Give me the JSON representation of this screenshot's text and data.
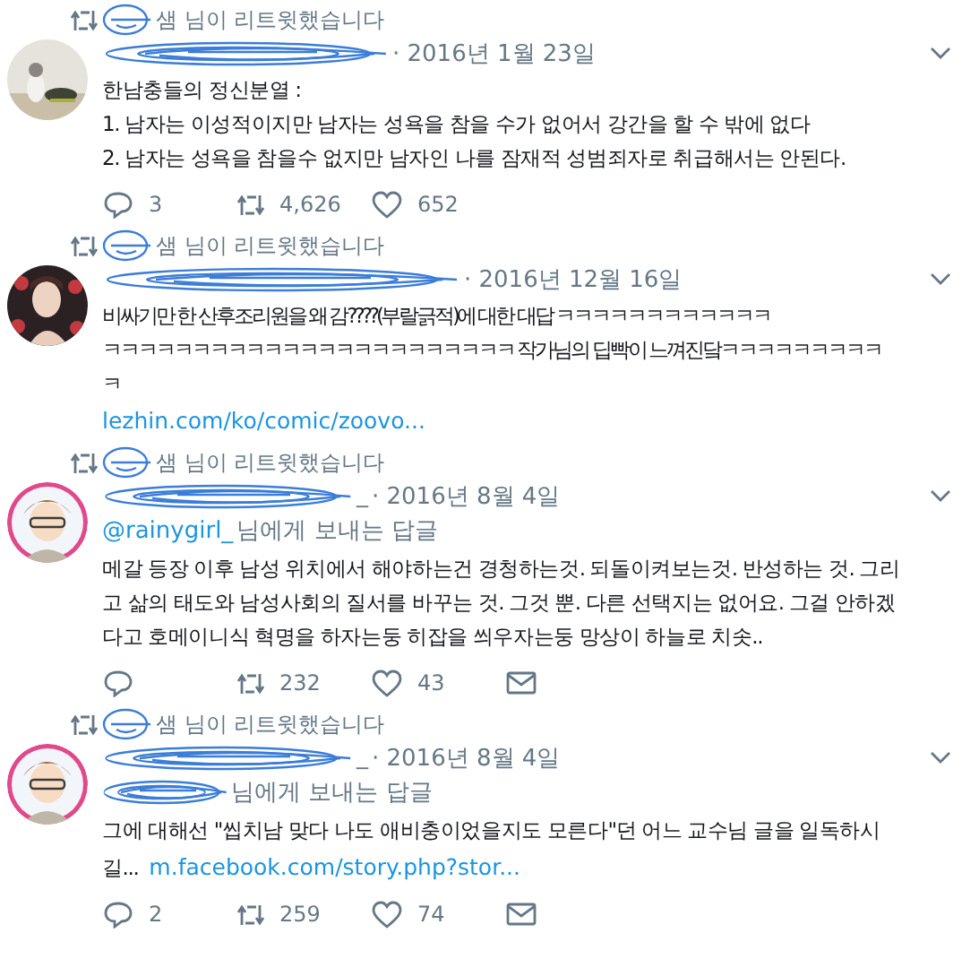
{
  "tweets": [
    {
      "retweet_label": "샘 님이 리트윗했습니다",
      "date": "· 2016년 1월 23일",
      "lines": [
        "한남충들의 정신분열 :",
        "1. 남자는 이성적이지만 남자는 성욕을 참을 수가 없어서 강간을 할 수 밖에 없다",
        "2. 남자는 성욕을 참을수 없지만 남자인 나를 잠재적 성범죄자로 취급해서는 안된다."
      ],
      "actions": [
        {
          "kind": "reply",
          "count": "3"
        },
        {
          "kind": "retweet",
          "count": "4,626"
        },
        {
          "kind": "like",
          "count": "652"
        }
      ]
    },
    {
      "retweet_label": "샘 님이 리트윗했습니다",
      "date": "· 2016년 12월 16일",
      "lines": [
        "비싸기만 한 산후조리원을 왜 감????(부랄긁적)에 대한 대답 ㅋㅋㅋㅋㅋㅋㅋㅋㅋㅋㅋㅋ",
        "ㅋㅋㅋㅋㅋㅋㅋㅋㅋㅋㅋㅋㅋㅋㅋㅋㅋㅋㅋㅋㅋㅋㅋ 작가님의 딥빡이 느껴진닼ㅋㅋㅋㅋㅋㅋㅋㅋㅋ",
        "ㅋ"
      ],
      "link": "lezhin.com/ko/comic/zoovo...",
      "link_inline": false
    },
    {
      "retweet_label": "샘 님이 리트윗했습니다",
      "name_tail": "_",
      "date": "· 2016년 8월 4일",
      "reply_to": {
        "handle": "@rainygirl_",
        "label": "님에게 보내는 답글"
      },
      "lines": [
        "메갈 등장 이후 남성 위치에서 해야하는건 경청하는것. 되돌이켜보는것. 반성하는 것. 그리",
        "고 삶의 태도와 남성사회의 질서를 바꾸는 것. 그것 뿐. 다른 선택지는 없어요. 그걸 안하겠",
        "다고 호메이니식 혁명을 하자는둥 히잡을 씌우자는둥 망상이 하늘로 치솟.."
      ],
      "actions": [
        {
          "kind": "reply"
        },
        {
          "kind": "retweet",
          "count": "232"
        },
        {
          "kind": "like",
          "count": "43"
        },
        {
          "kind": "message"
        }
      ]
    },
    {
      "retweet_label": "샘 님이 리트윗했습니다",
      "name_tail": "_",
      "date": "· 2016년 8월 4일",
      "reply_to": {
        "label": "님에게 보내는 답글"
      },
      "lines": [
        "그에 대해선 \"씹치남 맞다 나도 애비충이었을지도 모른다\"던 어느 교수님 글을 일독하시",
        "길..."
      ],
      "link": "m.facebook.com/story.php?stor...",
      "link_inline": true,
      "actions": [
        {
          "kind": "reply",
          "count": "2"
        },
        {
          "kind": "retweet",
          "count": "259"
        },
        {
          "kind": "like",
          "count": "74"
        },
        {
          "kind": "message"
        }
      ]
    }
  ]
}
